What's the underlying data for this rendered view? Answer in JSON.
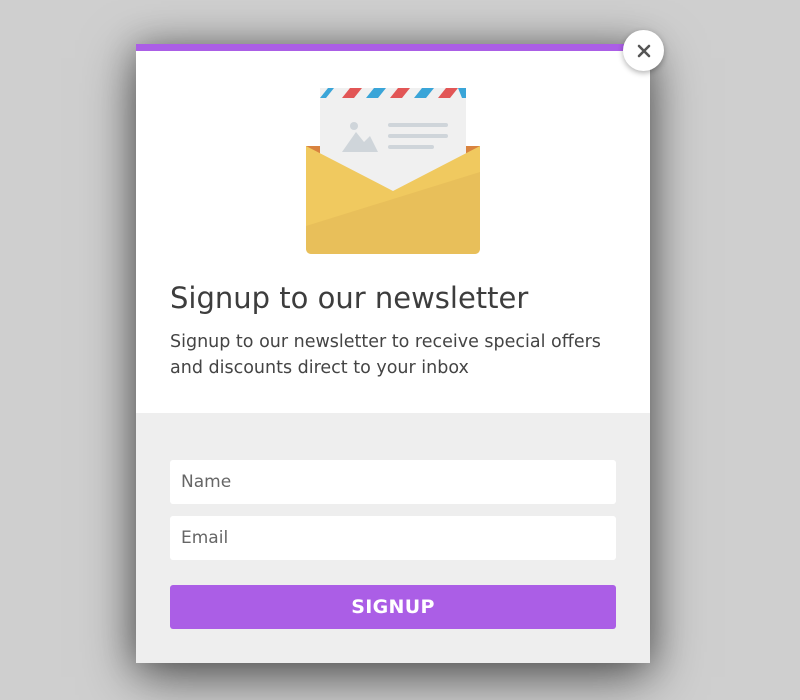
{
  "colors": {
    "accent": "#ab5ee6",
    "page_background": "#cfcfcf",
    "form_background": "#eeeeee"
  },
  "close_button": {
    "icon": "close-icon"
  },
  "illustration": {
    "icon": "envelope-letter-icon"
  },
  "header": {
    "title": "Signup to our newsletter",
    "description": "Signup to our newsletter to receive special offers and discounts direct to your inbox"
  },
  "form": {
    "name_placeholder": "Name",
    "email_placeholder": "Email",
    "submit_label": "SIGNUP"
  }
}
